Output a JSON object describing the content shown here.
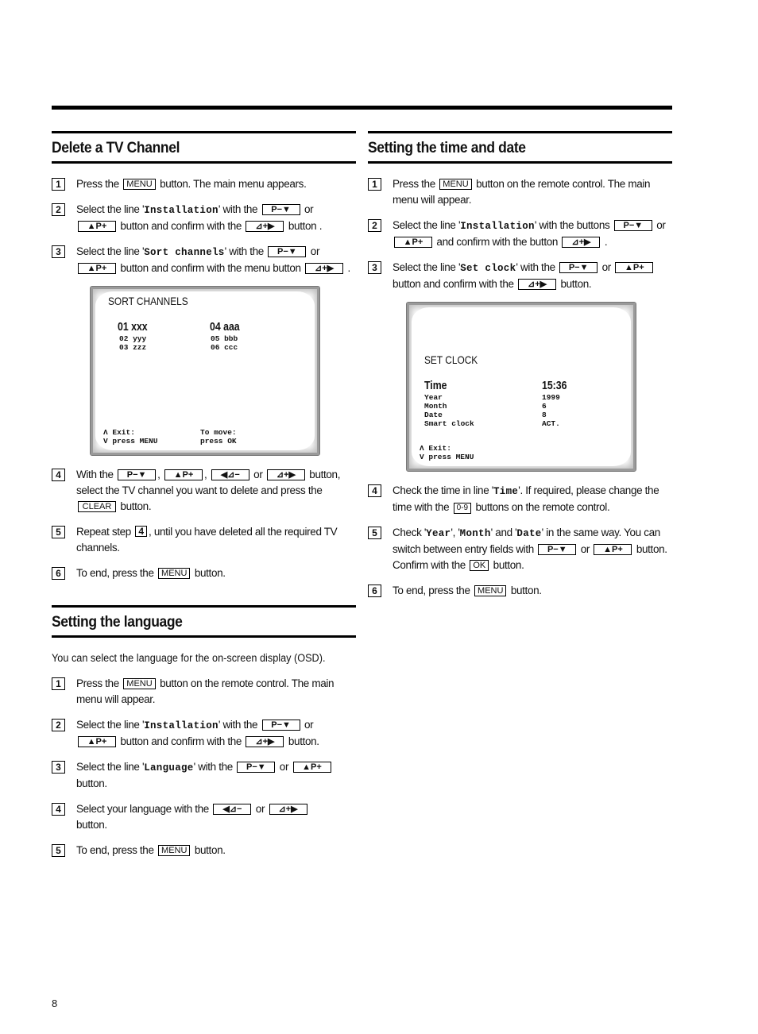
{
  "page_number": "8",
  "left": {
    "delete": {
      "title": "Delete a TV Channel",
      "steps": [
        {
          "n": "1",
          "a": "Press the",
          "b1": "MENU",
          "c": "button. The main menu appears."
        },
        {
          "n": "2",
          "a": "Select the line '",
          "m": "Installation",
          "b": "' with the",
          "b1": "P−▼",
          "c": "or",
          "b2": "▲P+",
          "d": "button and confirm with the",
          "b3": "⊿+▶",
          "e": "button ."
        },
        {
          "n": "3",
          "a": "Select the line '",
          "m": "Sort channels",
          "b": "' with the",
          "b1": "P−▼",
          "c": "or",
          "b2": "▲P+",
          "d": "button and confirm with the menu button",
          "b3": "⊿+▶",
          "e": "."
        },
        {
          "n": "4",
          "a": "With the",
          "b1": "P−▼",
          "b2": "▲P+",
          "b3": "◀⊿−",
          "c": "or",
          "b4": "⊿+▶",
          "d": "button, select the TV channel you want to delete and press the",
          "b5": "CLEAR",
          "e": "button."
        },
        {
          "n": "5",
          "a": "Repeat step",
          "ref": "4",
          "b": ",  until you have deleted all the required TV channels."
        },
        {
          "n": "6",
          "a": "To end, press the",
          "b1": "MENU",
          "c": "button."
        }
      ],
      "screen": {
        "title": "SORT CHANNELS",
        "col1_big": "01 xxx",
        "col1_small": "02 yyy\n03 zzz",
        "col2_big": "04 aaa",
        "col2_small": "05 bbb\n06 ccc",
        "footer_left": "Λ Exit:\nV press MENU",
        "footer_right": "To move:\npress OK"
      }
    },
    "language": {
      "title": "Setting the language",
      "intro": "You can select the language for the on-screen display (OSD).",
      "steps": [
        {
          "n": "1",
          "a": "Press the",
          "b1": "MENU",
          "c": "button on the remote control. The main menu will appear."
        },
        {
          "n": "2",
          "a": "Select the line '",
          "m": "Installation",
          "b": "' with the",
          "b1": "P−▼",
          "c": "or",
          "b2": "▲P+",
          "d": "button and confirm with the",
          "b3": "⊿+▶",
          "e": "button."
        },
        {
          "n": "3",
          "a": "Select the line '",
          "m": "Language",
          "b": "' with the",
          "b1": "P−▼",
          "c": "or",
          "b2": "▲P+",
          "d": "button."
        },
        {
          "n": "4",
          "a": "Select your language with the",
          "b1": "◀⊿−",
          "c": "or",
          "b2": "⊿+▶",
          "d": "button."
        },
        {
          "n": "5",
          "a": "To end, press the",
          "b1": "MENU",
          "c": "button."
        }
      ]
    }
  },
  "right": {
    "time": {
      "title": "Setting the time and date",
      "steps": [
        {
          "n": "1",
          "a": "Press the",
          "b1": "MENU",
          "c": "button on the remote control. The main menu will appear."
        },
        {
          "n": "2",
          "a": "Select the line '",
          "m": "Installation",
          "b": "' with the buttons",
          "b1": "P−▼",
          "c": "or",
          "b2": "▲P+",
          "d": "and confirm with the button",
          "b3": "⊿+▶",
          "e": "."
        },
        {
          "n": "3",
          "a": "Select the line '",
          "m": "Set clock",
          "b": "' with the",
          "b1": "P−▼",
          "c": "or",
          "b2": "▲P+",
          "d": "button and confirm with the",
          "b3": "⊿+▶",
          "e": "button."
        },
        {
          "n": "4",
          "a": "Check the time in line '",
          "m": "Time",
          "b": "'. If required, please change the time with the",
          "b1": "0-9",
          "c": "buttons on the remote control."
        },
        {
          "n": "5",
          "a": "Check '",
          "m1": "Year",
          "s1": "', '",
          "m2": "Month",
          "s2": "' and '",
          "m3": "Date",
          "b": "' in the same way. You can switch between entry fields with",
          "b1": "P−▼",
          "c": "or",
          "b2": "▲P+",
          "d": "button. Confirm with the",
          "b3": "OK",
          "e": "button."
        },
        {
          "n": "6",
          "a": "To end, press the",
          "b1": "MENU",
          "c": "button."
        }
      ],
      "screen": {
        "title": "SET CLOCK",
        "rows_big_label": "Time",
        "rows_big_value": "15:36",
        "rows_labels": "Year\nMonth\nDate\nSmart clock",
        "rows_values": "1999\n6\n8\nACT.",
        "footer_left": "Λ Exit:\nV press MENU"
      }
    }
  }
}
